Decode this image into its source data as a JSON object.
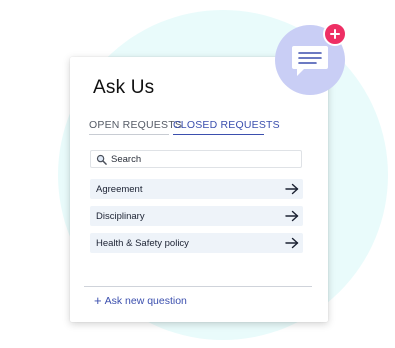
{
  "panel": {
    "title": "Ask Us"
  },
  "tabs": [
    {
      "label": "OPEN REQUESTS",
      "active": false
    },
    {
      "label": "CLOSED REQUESTS",
      "active": true
    }
  ],
  "search": {
    "placeholder": "Search",
    "value": ""
  },
  "requests": [
    {
      "label": "Agreement"
    },
    {
      "label": "Disciplinary"
    },
    {
      "label": "Health & Safety policy"
    }
  ],
  "actions": {
    "ask_new_label": "Ask new question",
    "ask_new_plus": "+"
  },
  "icons": {
    "search": "search-icon",
    "row_arrow": "arrow-right-icon",
    "chat": "chat-bubble-icon",
    "badge": "plus-icon"
  },
  "colors": {
    "accent": "#3b4fae",
    "badge": "#ee2f64",
    "chat_circle": "#c9cef5",
    "row_bg": "#eef3f9",
    "background_circle": "#e9fbfb"
  }
}
